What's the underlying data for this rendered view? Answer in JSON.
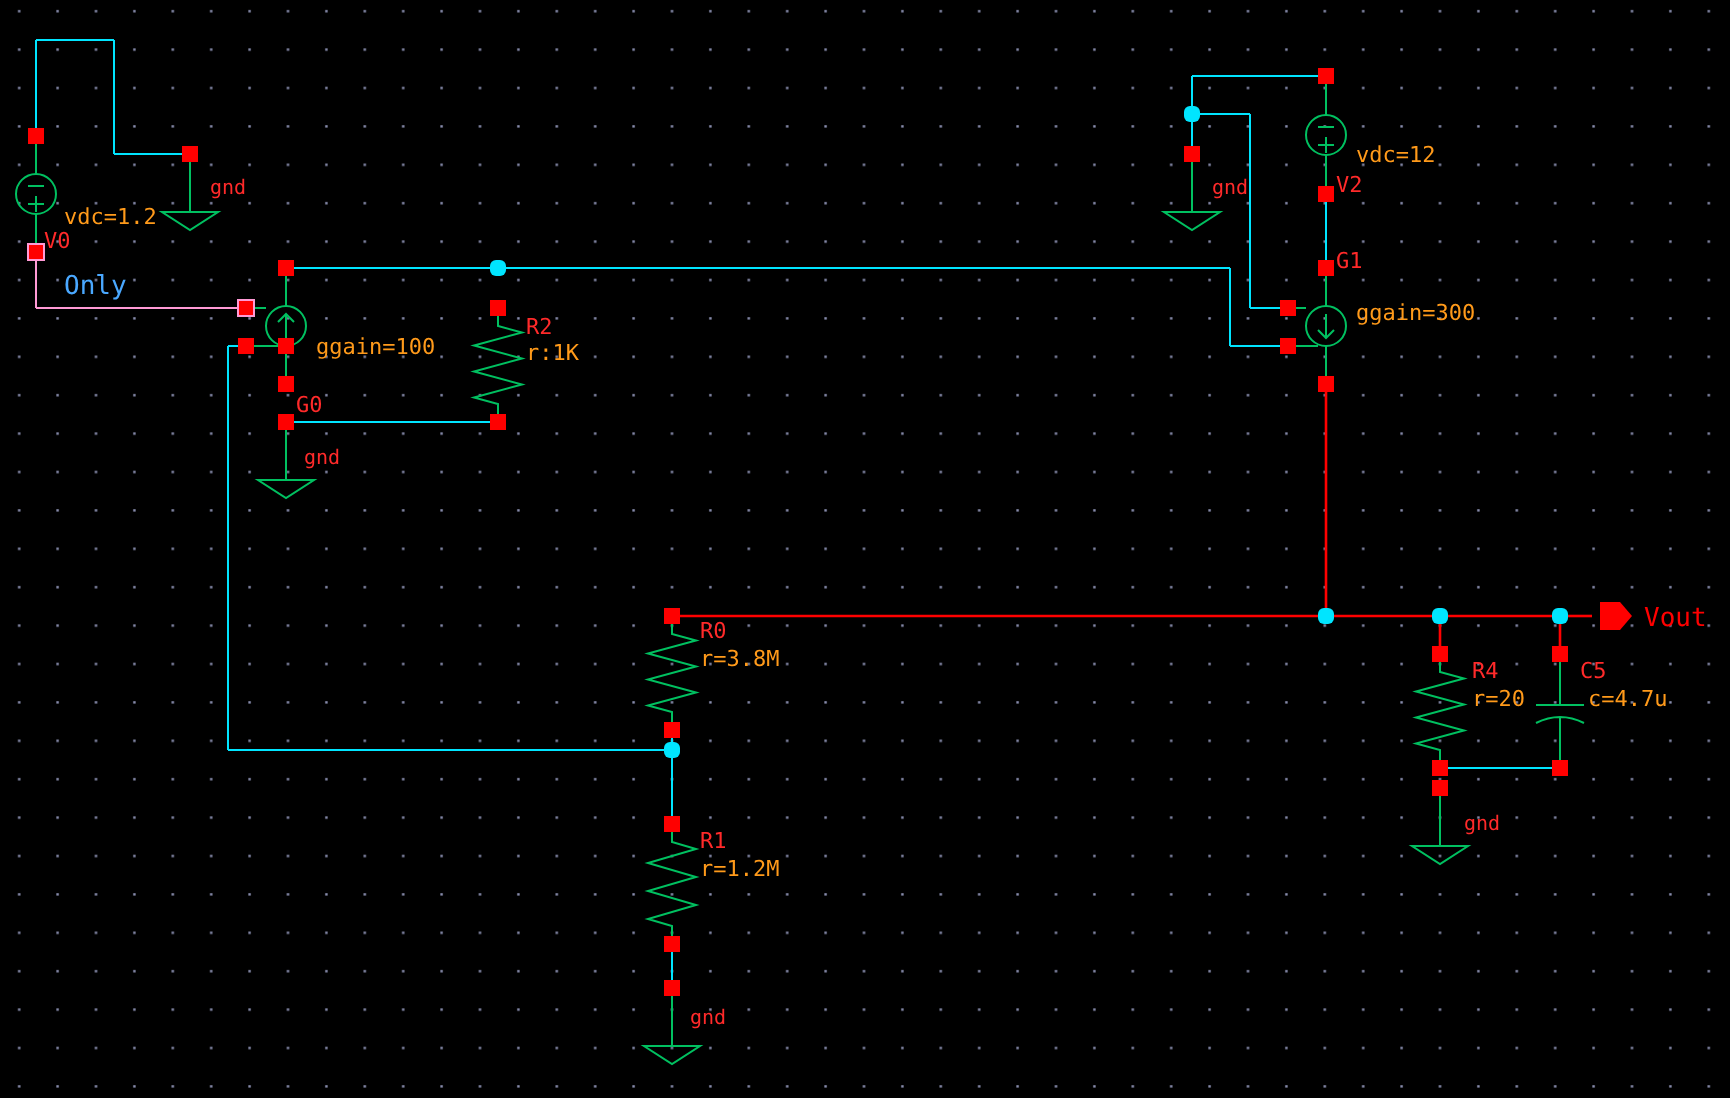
{
  "schematic": {
    "components": [
      {
        "kind": "vsource",
        "name": "V0",
        "value": "vdc=1.2"
      },
      {
        "kind": "vccs",
        "name": "G0",
        "value": "ggain=100"
      },
      {
        "kind": "resistor",
        "name": "R2",
        "value": "r:1K"
      },
      {
        "kind": "vsource",
        "name": "V2",
        "value": "vdc=12"
      },
      {
        "kind": "vccs",
        "name": "G1",
        "value": "ggain=300"
      },
      {
        "kind": "resistor",
        "name": "R0",
        "value": "r=3.8M"
      },
      {
        "kind": "resistor",
        "name": "R1",
        "value": "r=1.2M"
      },
      {
        "kind": "resistor",
        "name": "R4",
        "value": "r=20"
      },
      {
        "kind": "capacitor",
        "name": "C5",
        "value": "c=4.7u"
      }
    ],
    "grounds": [
      {
        "label": "gnd"
      },
      {
        "label": "gnd"
      },
      {
        "label": "gnd"
      },
      {
        "label": "gnd"
      },
      {
        "label": "gnd"
      }
    ],
    "net_labels": [
      {
        "label": "Only"
      }
    ],
    "output_pins": [
      {
        "label": "Vout"
      }
    ]
  }
}
